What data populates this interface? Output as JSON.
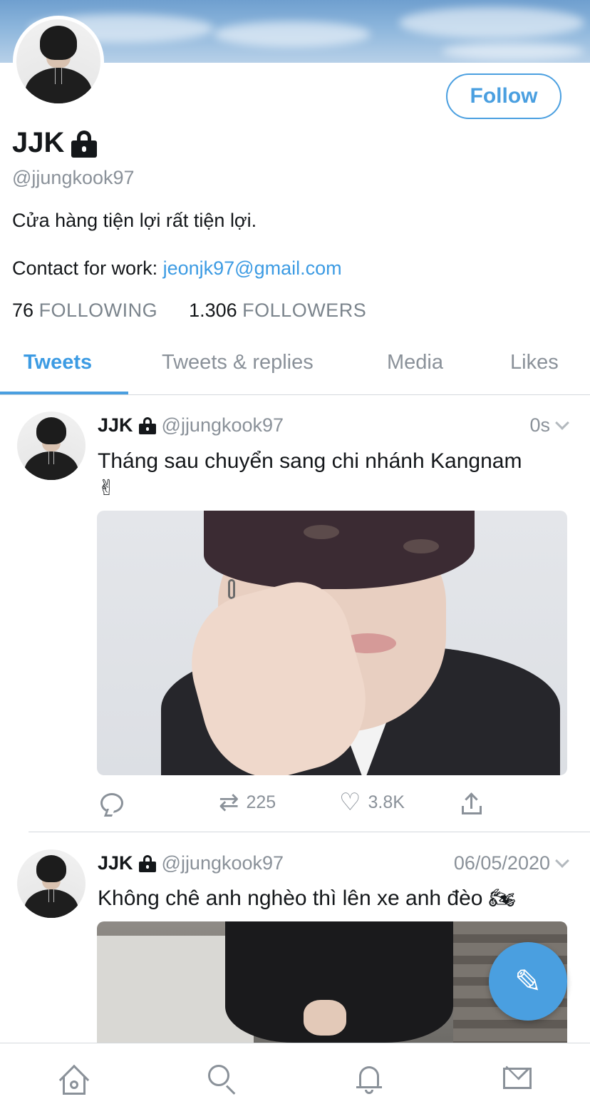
{
  "profile": {
    "display_name": "JJK",
    "handle": "@jjungkook97",
    "bio": "Cửa hàng tiện lợi rất tiện lợi.",
    "contact_prefix": "Contact for work: ",
    "contact_email": "jeonjk97@gmail.com",
    "following_count": "76",
    "following_label": "FOLLOWING",
    "followers_count": "1.306",
    "followers_label": "FOLLOWERS",
    "follow_button": "Follow",
    "locked": true
  },
  "tabs": [
    {
      "label": "Tweets",
      "active": true
    },
    {
      "label": "Tweets & replies",
      "active": false
    },
    {
      "label": "Media",
      "active": false
    },
    {
      "label": "Likes",
      "active": false
    }
  ],
  "tweets": [
    {
      "name": "JJK",
      "handle": "@jjungkook97",
      "time": "0s",
      "text": "Tháng sau chuyển sang chi nhánh Kangnam",
      "emoji": "✌",
      "retweets": "225",
      "likes": "3.8K"
    },
    {
      "name": "JJK",
      "handle": "@jjungkook97",
      "time": "06/05/2020",
      "text": "Không chê anh nghèo thì lên xe anh đèo",
      "emoji": "🏍"
    }
  ],
  "colors": {
    "accent": "#4a9fe0",
    "link": "#3c9be3",
    "muted": "#8a9199",
    "text": "#14171a"
  },
  "icons": {
    "fab": "compose-tweet-icon",
    "nav": [
      "home-icon",
      "search-icon",
      "notifications-bell-icon",
      "messages-mail-icon"
    ]
  }
}
